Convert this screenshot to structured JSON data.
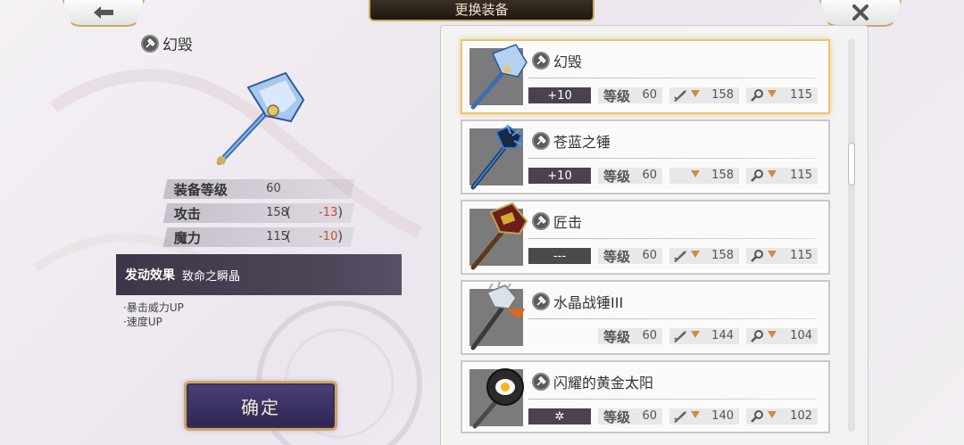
{
  "header": {
    "title": "更换装备",
    "back_icon": "back-arrow-icon",
    "close_icon": "close-icon"
  },
  "current": {
    "name": "幻毁",
    "stats": [
      {
        "label": "装备等级",
        "value": "60",
        "diff": ""
      },
      {
        "label": "攻击",
        "value": "158",
        "diff": "-13"
      },
      {
        "label": "魔力",
        "value": "115",
        "diff": "-10"
      }
    ],
    "effect_label": "发动效果",
    "effect_value": "致命之瞬晶",
    "effect_lines": [
      "·暴击威力UP",
      "·速度UP"
    ],
    "confirm_label": "确定"
  },
  "list": {
    "level_label": "等级",
    "items": [
      {
        "name": "幻毁",
        "refine": "+10",
        "level": "60",
        "atk": "158",
        "mag": "115",
        "selected": true
      },
      {
        "name": "苍蓝之锤",
        "refine": "+10",
        "level": "60",
        "atk": "158",
        "mag": "115",
        "selected": false
      },
      {
        "name": "匠击",
        "refine": "---",
        "level": "60",
        "atk": "158",
        "mag": "115",
        "selected": false
      },
      {
        "name": "水晶战锤III",
        "refine": "",
        "level": "60",
        "atk": "144",
        "mag": "104",
        "selected": false
      },
      {
        "name": "闪耀的黄金太阳",
        "refine": "✲",
        "level": "60",
        "atk": "140",
        "mag": "102",
        "selected": false
      }
    ]
  },
  "colors": {
    "accent_gold": "#c9a862",
    "down_arrow": "#d48a3a",
    "stat_decrease": "#c0502e"
  }
}
